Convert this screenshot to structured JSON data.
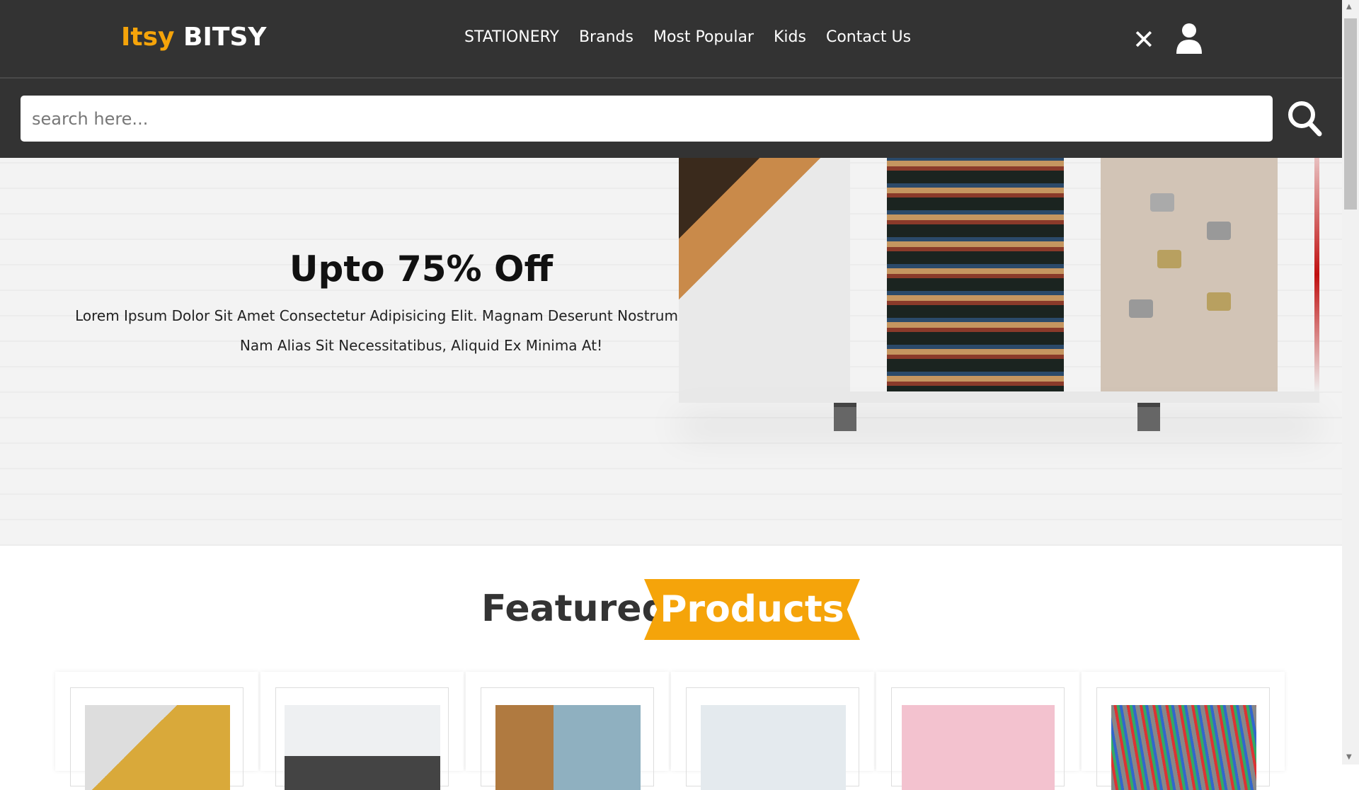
{
  "header": {
    "logo_accent": "Itsy",
    "logo_main": "BITSY",
    "nav": [
      "STATIONERY",
      "Brands",
      "Most Popular",
      "Kids",
      "Contact Us"
    ],
    "close_icon": "close-icon",
    "user_icon": "user-icon"
  },
  "search": {
    "placeholder": "search here...",
    "value": ""
  },
  "hero": {
    "title": "Upto 75% Off",
    "text": "Lorem Ipsum Dolor Sit Amet Consectetur Adipisicing Elit. Magnam Deserunt Nostrum Accusamus. Nam Alias Sit Necessitatibus, Aliquid Ex Minima At!"
  },
  "featured": {
    "word1": "Featured",
    "word2": "Products"
  },
  "colors": {
    "accent": "#f5a40a",
    "header_bg": "#333333"
  }
}
